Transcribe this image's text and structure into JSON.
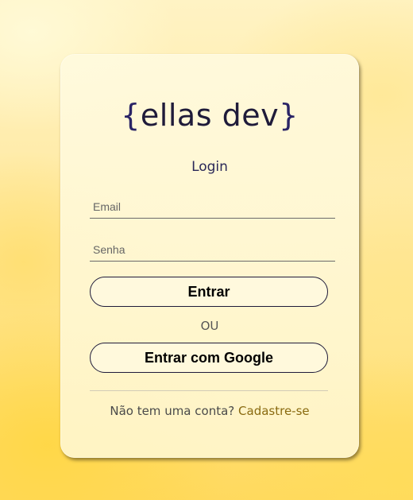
{
  "logo": {
    "open_brace": "{",
    "name": "ellas dev",
    "close_brace": "}"
  },
  "login": {
    "title": "Login",
    "email_placeholder": "Email",
    "password_placeholder": "Senha",
    "submit_label": "Entrar",
    "separator": "OU",
    "google_label": "Entrar com Google"
  },
  "signup": {
    "prompt": "Não tem uma conta?",
    "link_label": "Cadastre-se"
  },
  "colors": {
    "accent_link": "#8a6a10",
    "brand_dark": "#1f1b3a"
  }
}
